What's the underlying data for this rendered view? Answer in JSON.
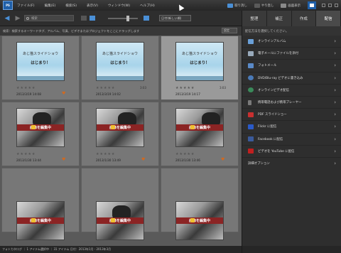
{
  "menubar": {
    "logo_label": "PS",
    "items": [
      "ファイル(F)",
      "編集(E)",
      "検索(S)",
      "表示(V)",
      "ウィンドウ(W)",
      "ヘルプ(H)"
    ],
    "right": {
      "undo_label": "取り消し",
      "redo_label": "やり直し",
      "display_label": "画面表示"
    }
  },
  "toolbar": {
    "search_placeholder": "検索",
    "date_select": "日付(新しい順)"
  },
  "hintbar": {
    "text": "検索：検索するキーワードタグ、アルバム、写真、ビデオまたはプロジェクトをここにドラッグします",
    "select_label": "設定"
  },
  "grid": {
    "items": [
      {
        "kind": "slide",
        "title": "あじ猫スライドショウ",
        "subtitle": "はじまり！",
        "date": "2013/3/19 14:08",
        "duration": "",
        "selected": false
      },
      {
        "kind": "slide",
        "title": "あじ猫スライドショウ",
        "subtitle": "はじまり！",
        "date": "2013/3/19 14:02",
        "duration": "3:03",
        "selected": false
      },
      {
        "kind": "slide",
        "title": "あじ猫スライドショウ",
        "subtitle": "はじまり！",
        "date": "2013/3/19 14:17",
        "duration": "3:03",
        "selected": true
      },
      {
        "kind": "cat",
        "badge": "画像を編集中",
        "date": "2013/1/30 13:44",
        "selected": false
      },
      {
        "kind": "cat",
        "badge": "画像を編集中",
        "date": "2013/1/30 13:49",
        "selected": false
      },
      {
        "kind": "cat",
        "badge": "画像を編集中",
        "date": "2013/1/30 13:46",
        "selected": false
      },
      {
        "kind": "cat",
        "badge": "画像を編集中",
        "date": "",
        "selected": false
      },
      {
        "kind": "cat",
        "badge": "画像を編集中",
        "date": "",
        "selected": false
      },
      {
        "kind": "cat",
        "badge": "画像を編集中",
        "date": "",
        "selected": false
      }
    ]
  },
  "statusbar": {
    "text": "フォトカタログ ｜ 1 アイテム選択中 ｜ 31 アイテム 日付：2013年1月 - 2013年3月"
  },
  "rightpanel": {
    "tabs": [
      "整理",
      "補正",
      "作成",
      "配信"
    ],
    "active_tab": "配信",
    "hint": "配信方法を選択してください。",
    "items": [
      {
        "label": "オンラインアルバム",
        "icon": "album-icon",
        "color": "#6aa0d8"
      },
      {
        "label": "電子メールにファイルを添付",
        "icon": "email-attach-icon",
        "color": "#9ab"
      },
      {
        "label": "フォトメール",
        "icon": "photo-mail-icon",
        "color": "#5a8ac8"
      },
      {
        "label": "DVD/Blu-ray ビデオに書き込み",
        "icon": "disc-icon",
        "color": "#4a7ab8"
      },
      {
        "label": "オンラインビデオ配信",
        "icon": "globe-icon",
        "color": "#3a8a5a"
      },
      {
        "label": "携帯電話および携帯プレーヤー",
        "icon": "phone-icon",
        "color": "#7a7a7a"
      },
      {
        "label": "PDF スライドショー",
        "icon": "pdf-icon",
        "color": "#c83030"
      },
      {
        "label": "Flickr に配信",
        "icon": "flickr-icon",
        "color": "#2a5ac8"
      },
      {
        "label": "Facebook に配信",
        "icon": "facebook-icon",
        "color": "#3a5a9a"
      },
      {
        "label": "ビデオを YouTube に配信",
        "icon": "youtube-icon",
        "color": "#c02020"
      },
      {
        "label": "詳細オプション",
        "icon": "",
        "color": ""
      }
    ]
  }
}
